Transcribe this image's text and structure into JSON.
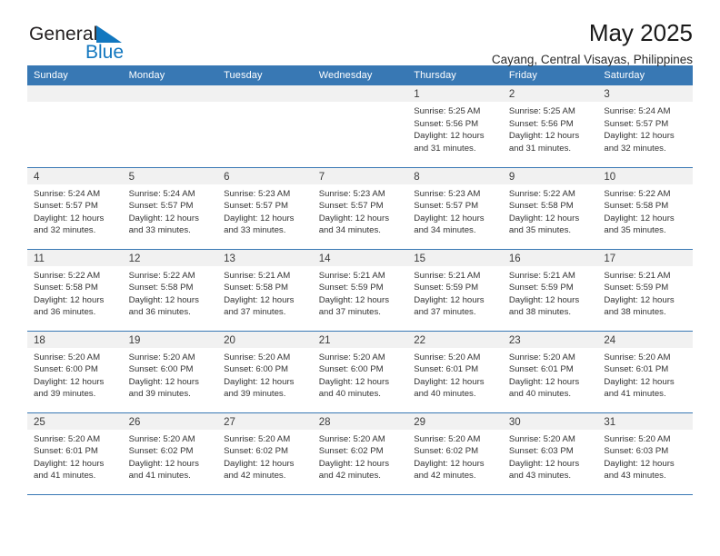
{
  "brand": {
    "name_part1": "General",
    "name_part2": "Blue",
    "flag_icon": "triangle-flag-icon",
    "color_dark": "#231f20",
    "color_blue": "#1277bf"
  },
  "header": {
    "title": "May 2025",
    "subtitle": "Cayang, Central Visayas, Philippines"
  },
  "theme": {
    "header_blue": "#3878b4",
    "daynum_band": "#f1f1f1",
    "row_divider": "#3878b4"
  },
  "calendar": {
    "weekday_headers": [
      "Sunday",
      "Monday",
      "Tuesday",
      "Wednesday",
      "Thursday",
      "Friday",
      "Saturday"
    ],
    "weeks": [
      [
        {
          "day": "",
          "sunrise": "",
          "sunset": "",
          "daylight_line1": "",
          "daylight_line2": ""
        },
        {
          "day": "",
          "sunrise": "",
          "sunset": "",
          "daylight_line1": "",
          "daylight_line2": ""
        },
        {
          "day": "",
          "sunrise": "",
          "sunset": "",
          "daylight_line1": "",
          "daylight_line2": ""
        },
        {
          "day": "",
          "sunrise": "",
          "sunset": "",
          "daylight_line1": "",
          "daylight_line2": ""
        },
        {
          "day": "1",
          "sunrise": "Sunrise: 5:25 AM",
          "sunset": "Sunset: 5:56 PM",
          "daylight_line1": "Daylight: 12 hours",
          "daylight_line2": "and 31 minutes."
        },
        {
          "day": "2",
          "sunrise": "Sunrise: 5:25 AM",
          "sunset": "Sunset: 5:56 PM",
          "daylight_line1": "Daylight: 12 hours",
          "daylight_line2": "and 31 minutes."
        },
        {
          "day": "3",
          "sunrise": "Sunrise: 5:24 AM",
          "sunset": "Sunset: 5:57 PM",
          "daylight_line1": "Daylight: 12 hours",
          "daylight_line2": "and 32 minutes."
        }
      ],
      [
        {
          "day": "4",
          "sunrise": "Sunrise: 5:24 AM",
          "sunset": "Sunset: 5:57 PM",
          "daylight_line1": "Daylight: 12 hours",
          "daylight_line2": "and 32 minutes."
        },
        {
          "day": "5",
          "sunrise": "Sunrise: 5:24 AM",
          "sunset": "Sunset: 5:57 PM",
          "daylight_line1": "Daylight: 12 hours",
          "daylight_line2": "and 33 minutes."
        },
        {
          "day": "6",
          "sunrise": "Sunrise: 5:23 AM",
          "sunset": "Sunset: 5:57 PM",
          "daylight_line1": "Daylight: 12 hours",
          "daylight_line2": "and 33 minutes."
        },
        {
          "day": "7",
          "sunrise": "Sunrise: 5:23 AM",
          "sunset": "Sunset: 5:57 PM",
          "daylight_line1": "Daylight: 12 hours",
          "daylight_line2": "and 34 minutes."
        },
        {
          "day": "8",
          "sunrise": "Sunrise: 5:23 AM",
          "sunset": "Sunset: 5:57 PM",
          "daylight_line1": "Daylight: 12 hours",
          "daylight_line2": "and 34 minutes."
        },
        {
          "day": "9",
          "sunrise": "Sunrise: 5:22 AM",
          "sunset": "Sunset: 5:58 PM",
          "daylight_line1": "Daylight: 12 hours",
          "daylight_line2": "and 35 minutes."
        },
        {
          "day": "10",
          "sunrise": "Sunrise: 5:22 AM",
          "sunset": "Sunset: 5:58 PM",
          "daylight_line1": "Daylight: 12 hours",
          "daylight_line2": "and 35 minutes."
        }
      ],
      [
        {
          "day": "11",
          "sunrise": "Sunrise: 5:22 AM",
          "sunset": "Sunset: 5:58 PM",
          "daylight_line1": "Daylight: 12 hours",
          "daylight_line2": "and 36 minutes."
        },
        {
          "day": "12",
          "sunrise": "Sunrise: 5:22 AM",
          "sunset": "Sunset: 5:58 PM",
          "daylight_line1": "Daylight: 12 hours",
          "daylight_line2": "and 36 minutes."
        },
        {
          "day": "13",
          "sunrise": "Sunrise: 5:21 AM",
          "sunset": "Sunset: 5:58 PM",
          "daylight_line1": "Daylight: 12 hours",
          "daylight_line2": "and 37 minutes."
        },
        {
          "day": "14",
          "sunrise": "Sunrise: 5:21 AM",
          "sunset": "Sunset: 5:59 PM",
          "daylight_line1": "Daylight: 12 hours",
          "daylight_line2": "and 37 minutes."
        },
        {
          "day": "15",
          "sunrise": "Sunrise: 5:21 AM",
          "sunset": "Sunset: 5:59 PM",
          "daylight_line1": "Daylight: 12 hours",
          "daylight_line2": "and 37 minutes."
        },
        {
          "day": "16",
          "sunrise": "Sunrise: 5:21 AM",
          "sunset": "Sunset: 5:59 PM",
          "daylight_line1": "Daylight: 12 hours",
          "daylight_line2": "and 38 minutes."
        },
        {
          "day": "17",
          "sunrise": "Sunrise: 5:21 AM",
          "sunset": "Sunset: 5:59 PM",
          "daylight_line1": "Daylight: 12 hours",
          "daylight_line2": "and 38 minutes."
        }
      ],
      [
        {
          "day": "18",
          "sunrise": "Sunrise: 5:20 AM",
          "sunset": "Sunset: 6:00 PM",
          "daylight_line1": "Daylight: 12 hours",
          "daylight_line2": "and 39 minutes."
        },
        {
          "day": "19",
          "sunrise": "Sunrise: 5:20 AM",
          "sunset": "Sunset: 6:00 PM",
          "daylight_line1": "Daylight: 12 hours",
          "daylight_line2": "and 39 minutes."
        },
        {
          "day": "20",
          "sunrise": "Sunrise: 5:20 AM",
          "sunset": "Sunset: 6:00 PM",
          "daylight_line1": "Daylight: 12 hours",
          "daylight_line2": "and 39 minutes."
        },
        {
          "day": "21",
          "sunrise": "Sunrise: 5:20 AM",
          "sunset": "Sunset: 6:00 PM",
          "daylight_line1": "Daylight: 12 hours",
          "daylight_line2": "and 40 minutes."
        },
        {
          "day": "22",
          "sunrise": "Sunrise: 5:20 AM",
          "sunset": "Sunset: 6:01 PM",
          "daylight_line1": "Daylight: 12 hours",
          "daylight_line2": "and 40 minutes."
        },
        {
          "day": "23",
          "sunrise": "Sunrise: 5:20 AM",
          "sunset": "Sunset: 6:01 PM",
          "daylight_line1": "Daylight: 12 hours",
          "daylight_line2": "and 40 minutes."
        },
        {
          "day": "24",
          "sunrise": "Sunrise: 5:20 AM",
          "sunset": "Sunset: 6:01 PM",
          "daylight_line1": "Daylight: 12 hours",
          "daylight_line2": "and 41 minutes."
        }
      ],
      [
        {
          "day": "25",
          "sunrise": "Sunrise: 5:20 AM",
          "sunset": "Sunset: 6:01 PM",
          "daylight_line1": "Daylight: 12 hours",
          "daylight_line2": "and 41 minutes."
        },
        {
          "day": "26",
          "sunrise": "Sunrise: 5:20 AM",
          "sunset": "Sunset: 6:02 PM",
          "daylight_line1": "Daylight: 12 hours",
          "daylight_line2": "and 41 minutes."
        },
        {
          "day": "27",
          "sunrise": "Sunrise: 5:20 AM",
          "sunset": "Sunset: 6:02 PM",
          "daylight_line1": "Daylight: 12 hours",
          "daylight_line2": "and 42 minutes."
        },
        {
          "day": "28",
          "sunrise": "Sunrise: 5:20 AM",
          "sunset": "Sunset: 6:02 PM",
          "daylight_line1": "Daylight: 12 hours",
          "daylight_line2": "and 42 minutes."
        },
        {
          "day": "29",
          "sunrise": "Sunrise: 5:20 AM",
          "sunset": "Sunset: 6:02 PM",
          "daylight_line1": "Daylight: 12 hours",
          "daylight_line2": "and 42 minutes."
        },
        {
          "day": "30",
          "sunrise": "Sunrise: 5:20 AM",
          "sunset": "Sunset: 6:03 PM",
          "daylight_line1": "Daylight: 12 hours",
          "daylight_line2": "and 43 minutes."
        },
        {
          "day": "31",
          "sunrise": "Sunrise: 5:20 AM",
          "sunset": "Sunset: 6:03 PM",
          "daylight_line1": "Daylight: 12 hours",
          "daylight_line2": "and 43 minutes."
        }
      ]
    ]
  }
}
